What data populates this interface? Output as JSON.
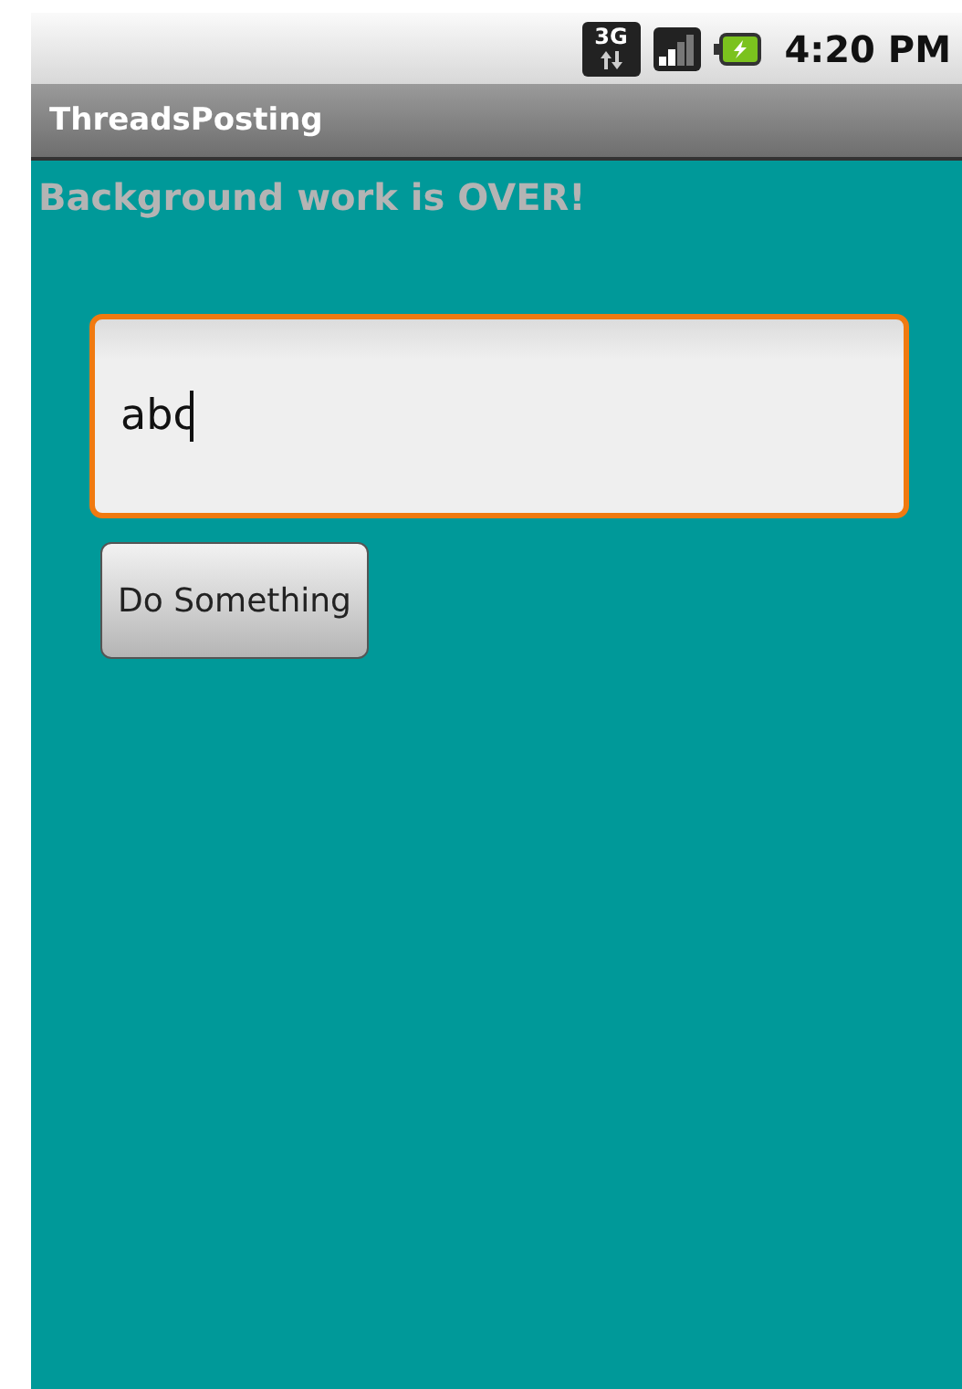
{
  "status_bar": {
    "network": "3G",
    "time": "4:20 PM"
  },
  "window": {
    "title": "ThreadsPosting"
  },
  "message": "Background work is OVER!",
  "text_field": {
    "value": "abc",
    "focused": true
  },
  "button": {
    "label": "Do Something"
  }
}
